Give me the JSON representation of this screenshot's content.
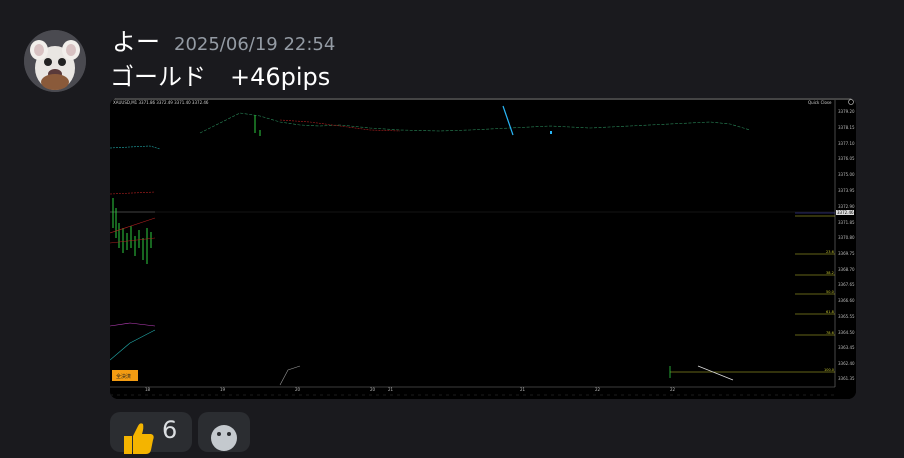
{
  "message": {
    "author": "よー",
    "timestamp": "2025/06/19 22:54",
    "content": "ゴールド　+46pips"
  },
  "chart": {
    "title": "XAUUSD,M1  3371.86 3372.49 3371.40 3372.46",
    "panel_label": "Quick Close",
    "button_label": "全決済",
    "current_price": "3372.46",
    "price_labels": [
      "3379.20",
      "3378.15",
      "3377.10",
      "3376.05",
      "3375.00",
      "3373.95",
      "3372.90",
      "3371.85",
      "3370.80",
      "3369.75",
      "3368.70",
      "3367.65",
      "3366.60",
      "3365.55",
      "3364.50",
      "3363.45",
      "3362.40",
      "3361.35"
    ],
    "date_labels": [
      "18",
      "19",
      "20",
      "20",
      "21",
      "21",
      "22",
      "22"
    ],
    "fib_labels": [
      "23.6",
      "38.2",
      "50.0",
      "61.8",
      "78.6",
      "100.0"
    ],
    "colors": {
      "ask_line": "#2196f3",
      "grid": "#444444",
      "up": "#2ecc40",
      "down": "#e8e8e8"
    }
  },
  "reactions": [
    {
      "icon": "thumbs-up-icon",
      "count": "6"
    },
    {
      "icon": "add-reaction-icon",
      "count": ""
    }
  ]
}
